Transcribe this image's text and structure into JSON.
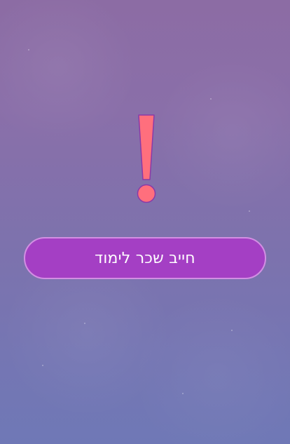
{
  "alert": {
    "icon": "exclamation-icon",
    "fill_color": "#ff6f7d",
    "stroke_color": "#8a3aa8"
  },
  "action": {
    "label": "חייב שכר לימוד",
    "background_color": "#a43fc4",
    "border_color": "#d28fe3"
  }
}
